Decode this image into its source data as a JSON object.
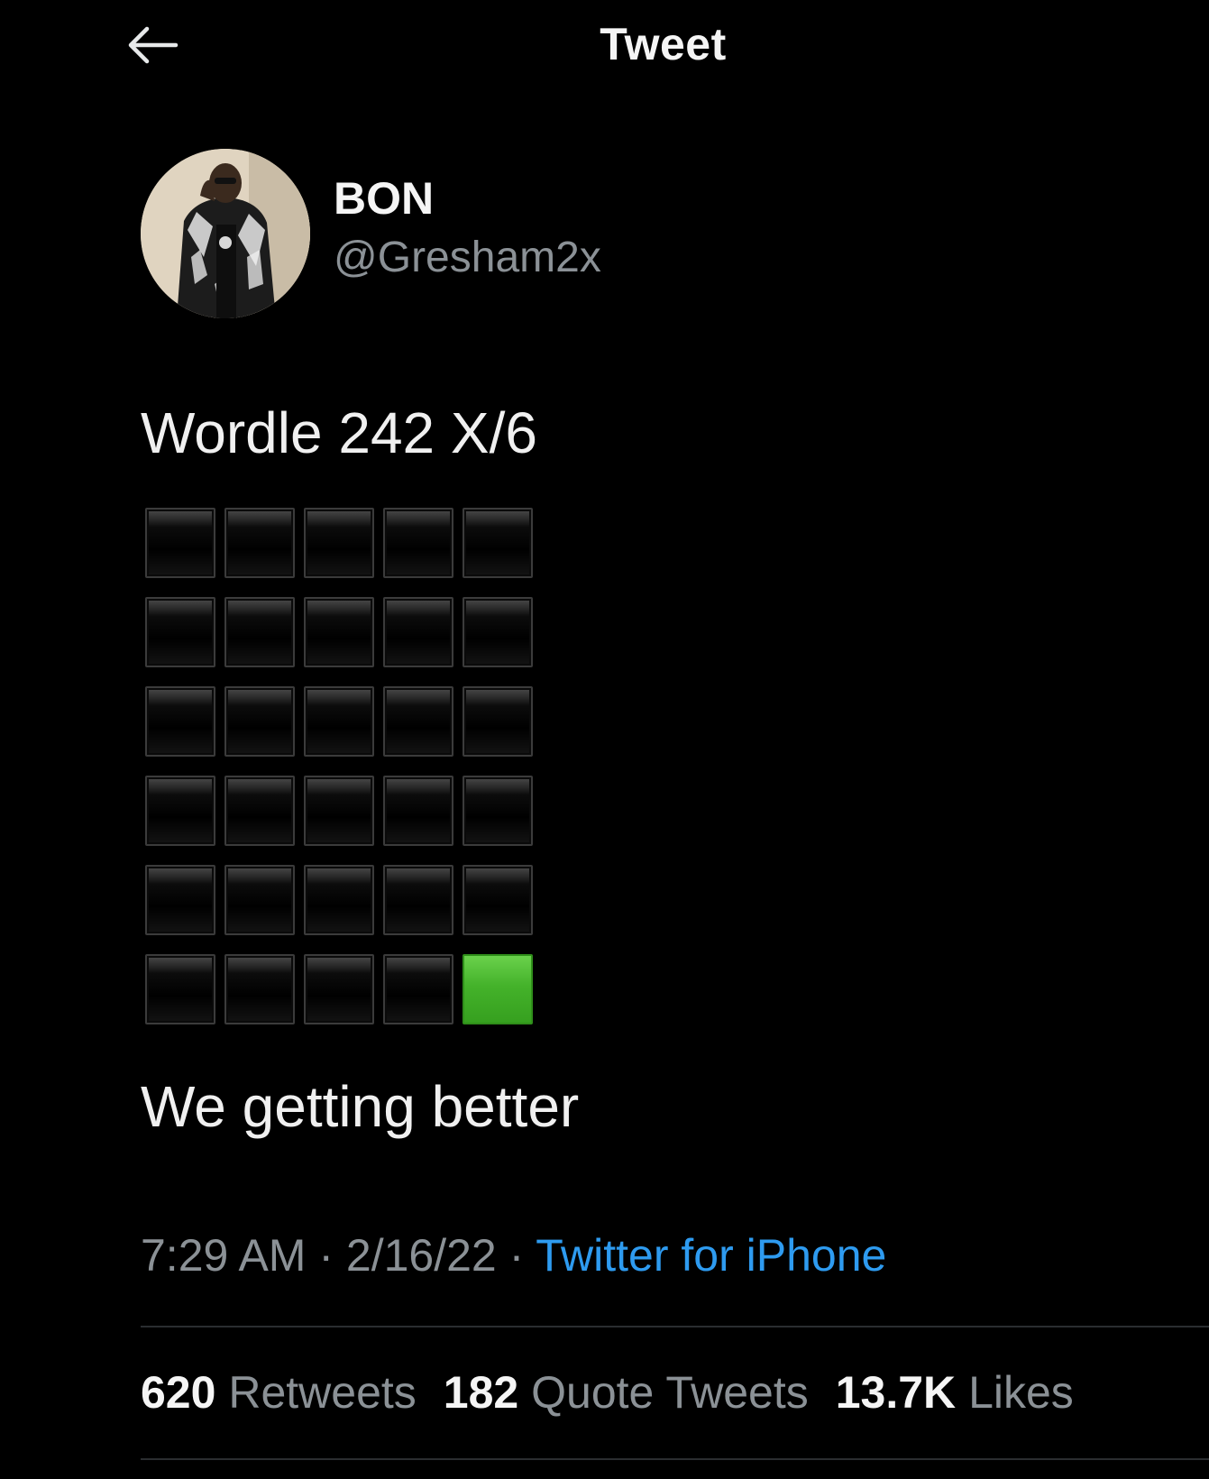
{
  "header": {
    "title": "Tweet",
    "back_icon": "arrow-left-icon"
  },
  "author": {
    "display_name": "BON",
    "handle": "@Gresham2x"
  },
  "tweet": {
    "headline": "Wordle 242 X/6",
    "caption": "We getting better",
    "wordle_rows": [
      [
        "black",
        "black",
        "black",
        "black",
        "black"
      ],
      [
        "black",
        "black",
        "black",
        "black",
        "black"
      ],
      [
        "black",
        "black",
        "black",
        "black",
        "black"
      ],
      [
        "black",
        "black",
        "black",
        "black",
        "black"
      ],
      [
        "black",
        "black",
        "black",
        "black",
        "black"
      ],
      [
        "black",
        "black",
        "black",
        "black",
        "green"
      ]
    ]
  },
  "meta": {
    "time": "7:29 AM",
    "separator": " · ",
    "date": "2/16/22",
    "source": "Twitter for iPhone"
  },
  "stats": {
    "retweets_count": "620",
    "retweets_label": "Retweets",
    "quote_count": "182",
    "quote_label": "Quote Tweets",
    "likes_count": "13.7K",
    "likes_label": "Likes"
  },
  "colors": {
    "background": "#000000",
    "text": "#e7e9ea",
    "secondary": "#8b9196",
    "link": "#2e9bf0",
    "tile_green": "#44b22a"
  }
}
